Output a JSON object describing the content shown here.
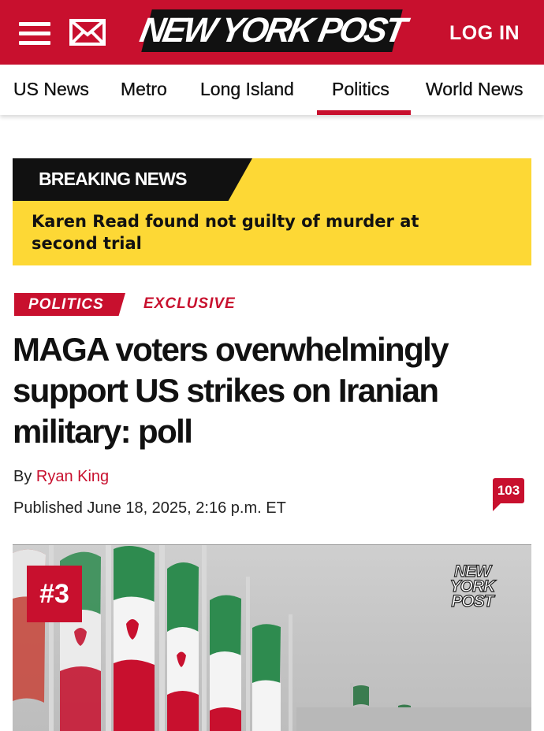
{
  "header": {
    "logo_text": "NEW YORK POST",
    "login_label": "LOG IN",
    "menu_icon": "hamburger-menu-icon",
    "mail_icon": "envelope-icon",
    "brand_color": "#c8102e"
  },
  "nav": {
    "items": [
      "US News",
      "Metro",
      "Long Island",
      "Politics",
      "World News"
    ],
    "active": "Politics"
  },
  "breaking": {
    "label": "BREAKING NEWS",
    "text": "Karen Read found not guilty of murder at second trial",
    "bg_color": "#fdd835"
  },
  "article": {
    "section_tag": "POLITICS",
    "exclusive_tag": "EXCLUSIVE",
    "headline": "MAGA voters overwhelmingly support US strikes on Iranian military: poll",
    "byline_prefix": "By",
    "author": "Ryan King",
    "published": "Published June 18, 2025, 2:16 p.m. ET",
    "comment_count": "103"
  },
  "photo": {
    "rank_badge": "#3",
    "logo_lines": [
      "NEW",
      "YORK",
      "POST"
    ],
    "description_icon": "iranian-flags-image"
  }
}
